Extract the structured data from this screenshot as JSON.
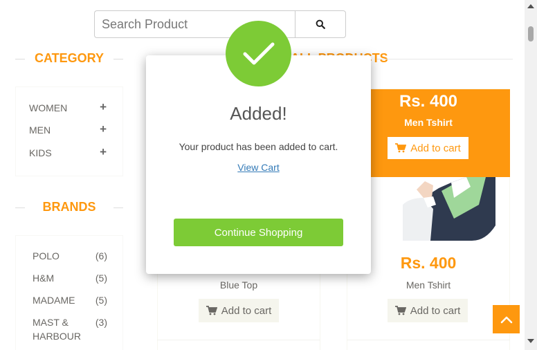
{
  "search": {
    "placeholder": "Search Product",
    "icon": "search-icon"
  },
  "sidebar": {
    "category_title": "CATEGORY",
    "categories": [
      {
        "label": "WOMEN",
        "toggle": "+"
      },
      {
        "label": "MEN",
        "toggle": "+"
      },
      {
        "label": "KIDS",
        "toggle": "+"
      }
    ],
    "brands_title": "BRANDS",
    "brands": [
      {
        "name": "POLO",
        "count": "(6)"
      },
      {
        "name": "H&M",
        "count": "(5)"
      },
      {
        "name": "MADAME",
        "count": "(5)"
      },
      {
        "name": "MAST & HARBOUR",
        "count": "(3)"
      }
    ]
  },
  "products": {
    "title": "ALL PRODUCTS",
    "visible_title_fragment": "ALL PRODUCTS",
    "overlay": {
      "price": "Rs. 400",
      "name": "Men Tshirt",
      "add_label": "Add to cart"
    },
    "left": {
      "name": "Blue Top",
      "add_label": "Add to cart"
    },
    "right": {
      "price": "Rs. 400",
      "name": "Men Tshirt",
      "add_label": "Add to cart"
    }
  },
  "modal": {
    "title": "Added!",
    "message": "Your product has been added to cart.",
    "link": "View Cart",
    "button": "Continue Shopping",
    "icon": "checkmark-icon"
  },
  "colors": {
    "accent": "#FE980F",
    "success": "#7DCB36",
    "link": "#337AB7"
  }
}
